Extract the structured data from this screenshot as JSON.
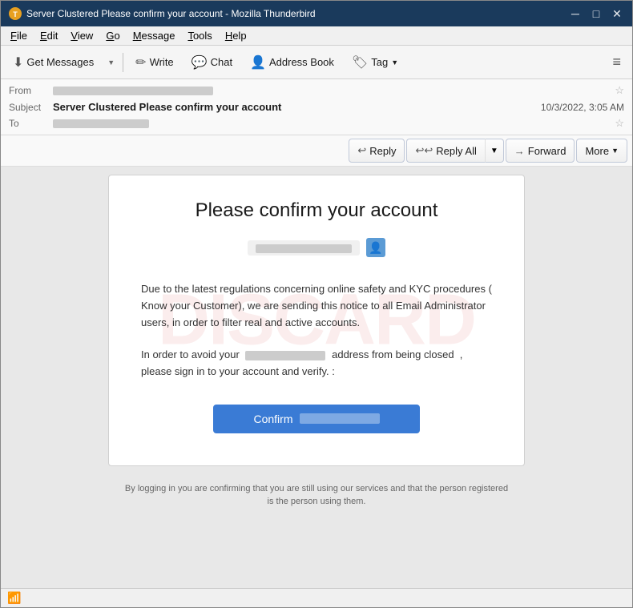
{
  "window": {
    "title": "Server Clustered Please confirm your account - Mozilla Thunderbird",
    "icon": "TB"
  },
  "titlebar": {
    "minimize_label": "─",
    "maximize_label": "□",
    "close_label": "✕"
  },
  "menubar": {
    "items": [
      {
        "id": "file",
        "label": "File"
      },
      {
        "id": "edit",
        "label": "Edit"
      },
      {
        "id": "view",
        "label": "View"
      },
      {
        "id": "go",
        "label": "Go"
      },
      {
        "id": "message",
        "label": "Message"
      },
      {
        "id": "tools",
        "label": "Tools"
      },
      {
        "id": "help",
        "label": "Help"
      }
    ]
  },
  "toolbar": {
    "get_messages_label": "Get Messages",
    "write_label": "Write",
    "chat_label": "Chat",
    "address_book_label": "Address Book",
    "tag_label": "Tag"
  },
  "email_header": {
    "from_label": "From",
    "from_value": "██████████████████████████",
    "subject_label": "Subject",
    "subject_value": "Server Clustered Please confirm your account",
    "date_value": "10/3/2022, 3:05 AM",
    "to_label": "To",
    "to_value": "████████████████"
  },
  "action_buttons": {
    "reply_label": "Reply",
    "reply_all_label": "Reply All",
    "forward_label": "Forward",
    "more_label": "More"
  },
  "email_body": {
    "card_title": "Please confirm your account",
    "email_placeholder": "████████████████",
    "body_text1": "Due to the latest regulations concerning online safety and KYC procedures ( Know your Customer), we are sending this notice to all Email Administrator users, in order to filter real and active accounts.",
    "body_text2_before": "In order to avoid your",
    "body_text2_redacted": "████████████████████",
    "body_text2_after": "address from being closed  ,\nplease sign in to your account and verify. :",
    "confirm_label": "Confirm",
    "confirm_redacted": "████████████████████",
    "footer_text": "By logging in you are confirming that you are still using our services and that the person registered is the person using them."
  },
  "watermark": {
    "text": "DISCARD"
  },
  "statusbar": {
    "wifi_icon": "📶"
  }
}
